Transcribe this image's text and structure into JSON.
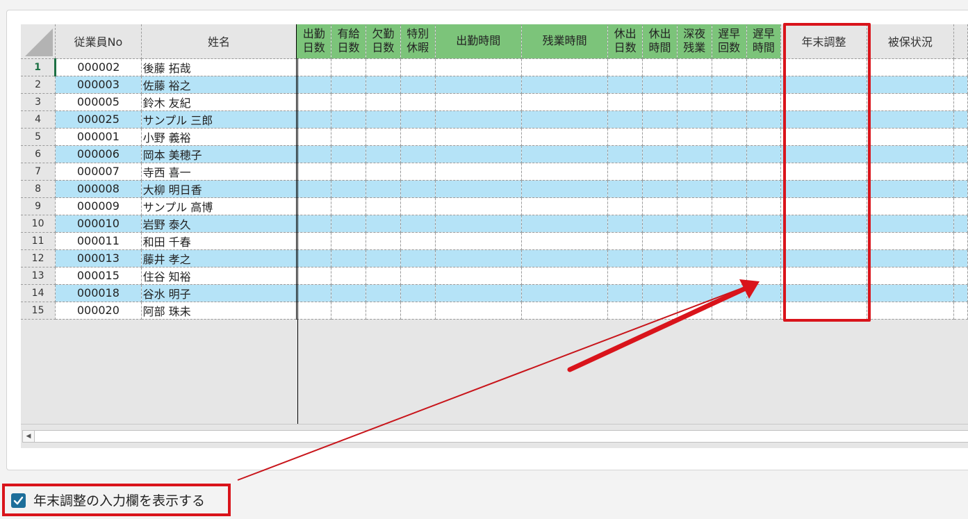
{
  "grid": {
    "headers": {
      "emp_no": "従業員No",
      "name": "姓名",
      "work_days": [
        "出勤",
        "日数"
      ],
      "paid_leave_days": [
        "有給",
        "日数"
      ],
      "absent_days": [
        "欠勤",
        "日数"
      ],
      "special_leave": [
        "特別",
        "休暇"
      ],
      "work_hours": "出勤時間",
      "overtime_hours": "残業時間",
      "holiday_work_days": [
        "休出",
        "日数"
      ],
      "holiday_work_hours": [
        "休出",
        "時間"
      ],
      "late_night_overtime": [
        "深夜",
        "残業"
      ],
      "late_early_count": [
        "遅早",
        "回数"
      ],
      "late_early_hours": [
        "遅早",
        "時間"
      ],
      "year_end_adjustment": "年末調整",
      "insured_status": "被保状況"
    },
    "rows": [
      {
        "num": "1",
        "emp_no": "000002",
        "name": "後藤 拓哉"
      },
      {
        "num": "2",
        "emp_no": "000003",
        "name": "佐藤 裕之"
      },
      {
        "num": "3",
        "emp_no": "000005",
        "name": "鈴木 友紀"
      },
      {
        "num": "4",
        "emp_no": "000025",
        "name": "サンプル 三郎"
      },
      {
        "num": "5",
        "emp_no": "000001",
        "name": "小野 義裕"
      },
      {
        "num": "6",
        "emp_no": "000006",
        "name": "岡本 美穂子"
      },
      {
        "num": "7",
        "emp_no": "000007",
        "name": "寺西 喜一"
      },
      {
        "num": "8",
        "emp_no": "000008",
        "name": "大柳 明日香"
      },
      {
        "num": "9",
        "emp_no": "000009",
        "name": "サンプル 高博"
      },
      {
        "num": "10",
        "emp_no": "000010",
        "name": "岩野 泰久"
      },
      {
        "num": "11",
        "emp_no": "000011",
        "name": "和田 千春"
      },
      {
        "num": "12",
        "emp_no": "000013",
        "name": "藤井 孝之"
      },
      {
        "num": "13",
        "emp_no": "000015",
        "name": "住谷 知裕"
      },
      {
        "num": "14",
        "emp_no": "000018",
        "name": "谷水 明子"
      },
      {
        "num": "15",
        "emp_no": "000020",
        "name": "阿部 珠未"
      }
    ]
  },
  "option": {
    "label": "年末調整の入力欄を表示する",
    "checked": true
  },
  "colors": {
    "header_green": "#7cc47a",
    "row_blue": "#b5e3f7",
    "highlight_red": "#d9141b",
    "checkbox": "#1d6e9a"
  }
}
